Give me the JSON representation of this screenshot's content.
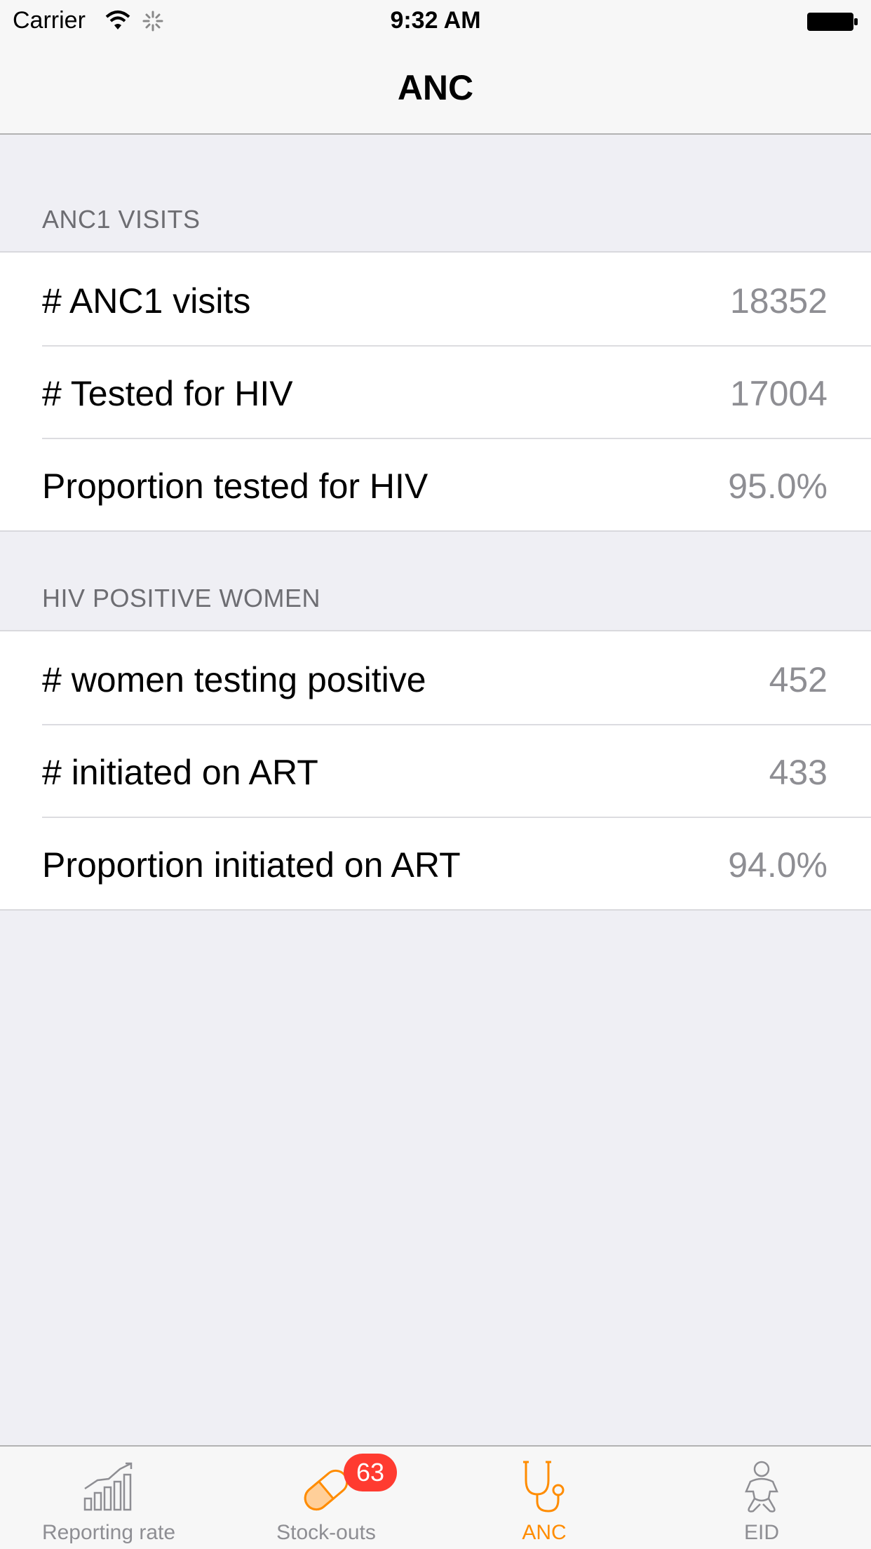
{
  "status_bar": {
    "carrier": "Carrier",
    "time": "9:32 AM"
  },
  "nav": {
    "title": "ANC"
  },
  "sections": [
    {
      "header": "ANC1 VISITS",
      "rows": [
        {
          "label": "# ANC1 visits",
          "value": "18352"
        },
        {
          "label": "# Tested for HIV",
          "value": "17004"
        },
        {
          "label": "Proportion tested for HIV",
          "value": "95.0%"
        }
      ]
    },
    {
      "header": "HIV POSITIVE WOMEN",
      "rows": [
        {
          "label": "# women testing positive",
          "value": "452"
        },
        {
          "label": "# initiated on ART",
          "value": "433"
        },
        {
          "label": "Proportion initiated on ART",
          "value": "94.0%"
        }
      ]
    }
  ],
  "tabbar": {
    "tabs": [
      {
        "label": "Reporting rate",
        "icon": "bar-chart-icon"
      },
      {
        "label": "Stock-outs",
        "icon": "pill-icon",
        "badge": "63"
      },
      {
        "label": "ANC",
        "icon": "stethoscope-icon",
        "active": true
      },
      {
        "label": "EID",
        "icon": "baby-icon"
      }
    ]
  },
  "colors": {
    "accent": "#ff8c00",
    "badge": "#ff3b30",
    "inactive": "#8e8e93",
    "background": "#efeff4"
  }
}
